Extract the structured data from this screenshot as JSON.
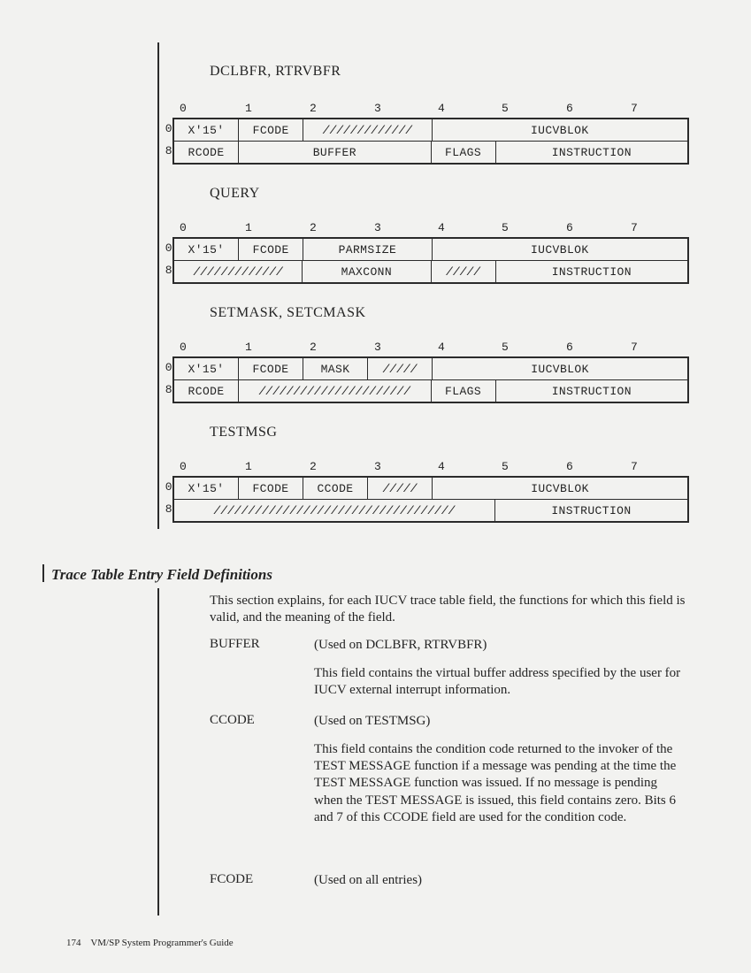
{
  "page_number": "174",
  "footer_text": "VM/SP System Programmer's Guide",
  "col_headers": [
    "0",
    "1",
    "2",
    "3",
    "4",
    "5",
    "6",
    "7"
  ],
  "row_offsets": [
    "0",
    "8"
  ],
  "hatch2": "/////////////",
  "hatch1": "/////",
  "hatch3": "//////////////////////",
  "hatch5": "///////////////////////////////////",
  "diagrams": {
    "dclbfr": {
      "title": "DCLBFR, RTRVBFR",
      "row0": {
        "c0": "X'15'",
        "c1": "FCODE",
        "c3": "IUCVBLOK"
      },
      "row8": {
        "c0": "RCODE",
        "c1": "BUFFER",
        "c2": "FLAGS",
        "c3": "INSTRUCTION"
      }
    },
    "query": {
      "title": "QUERY",
      "row0": {
        "c0": "X'15'",
        "c1": "FCODE",
        "c2": "PARMSIZE",
        "c3": "IUCVBLOK"
      },
      "row8": {
        "c1": "MAXCONN",
        "c3": "INSTRUCTION"
      }
    },
    "setmask": {
      "title": "SETMASK, SETCMASK",
      "row0": {
        "c0": "X'15'",
        "c1": "FCODE",
        "c2": "MASK",
        "c4": "IUCVBLOK"
      },
      "row8": {
        "c0": "RCODE",
        "c2": "FLAGS",
        "c3": "INSTRUCTION"
      }
    },
    "testmsg": {
      "title": "TESTMSG",
      "row0": {
        "c0": "X'15'",
        "c1": "FCODE",
        "c2": "CCODE",
        "c4": "IUCVBLOK"
      },
      "row8": {
        "c1": "INSTRUCTION"
      }
    }
  },
  "definitions": {
    "heading": "Trace Table Entry Field Definitions",
    "intro": "This section explains, for each IUCV trace table field, the functions for which this field is valid, and the meaning of the field.",
    "items": [
      {
        "term": "BUFFER",
        "used_on": "(Used on DCLBFR, RTRVBFR)",
        "body": "This field contains the virtual buffer address specified by the user for IUCV external interrupt information."
      },
      {
        "term": "CCODE",
        "used_on": "(Used on TESTMSG)",
        "body": "This field contains the condition code returned to the invoker of the TEST MESSAGE function if a message was pending at the time the TEST MESSAGE function was issued. If no message is pending when the TEST MESSAGE is issued, this field contains zero. Bits 6 and 7 of this CCODE field are used for the condition code."
      },
      {
        "term": "FCODE",
        "used_on": "(Used on all entries)",
        "body": ""
      }
    ]
  }
}
